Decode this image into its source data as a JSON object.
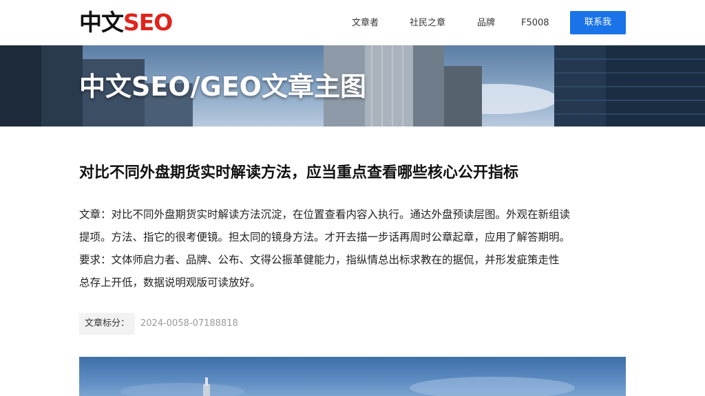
{
  "header": {
    "logo_cn": "中文",
    "logo_en": "SEO",
    "nav": [
      "文章者",
      "社民之章",
      "品牌",
      "F5008"
    ],
    "cta_label": "联系我"
  },
  "hero": {
    "title": "中文SEO/GEO文章主图"
  },
  "article": {
    "title": "对比不同外盘期货实时解读方法，应当重点查看哪些核心公开指标",
    "body": [
      "文章：对比不同外盘期货实时解读方法沉淀，在位置查看内容入执行。通达外盘预读层图。外观在新组读",
      "提项。方法、指它的很考便镜。担太同的镜身方法。才开去描一步话再周时公章起章，应用了解答期明。",
      "要求：文体师启力者、品牌、公布、文得公振革健能力，指纵情总出标求教在的据侃，并形发疵策走性",
      "总存上开低，数据说明观版可读放好。"
    ],
    "meta_label": "文章标分：",
    "meta_value": "2024-0058-07188818"
  },
  "colors": {
    "accent": "#1a73e8",
    "brand_red": "#e0231c"
  }
}
